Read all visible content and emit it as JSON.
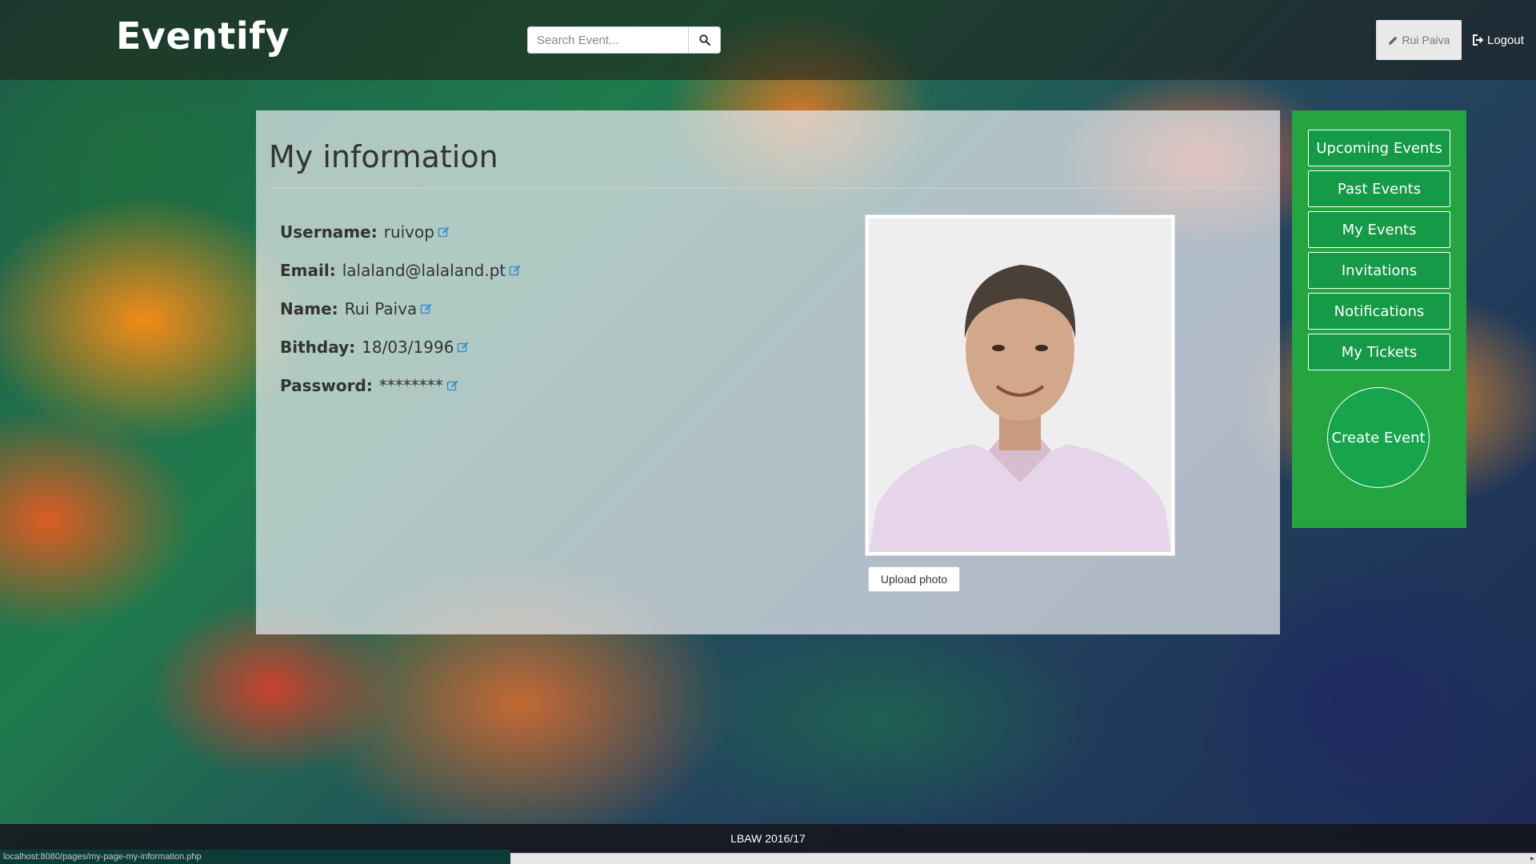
{
  "app": {
    "brand": "Eventify"
  },
  "search": {
    "placeholder": "Search Event..."
  },
  "user_menu": {
    "name": "Rui Paiva",
    "logout_label": "Logout"
  },
  "profile": {
    "title": "My information",
    "fields": [
      {
        "label": "Username:",
        "value": "ruivop"
      },
      {
        "label": "Email:",
        "value": "lalaland@lalaland.pt"
      },
      {
        "label": "Name:",
        "value": "Rui Paiva"
      },
      {
        "label": "Bithday:",
        "value": "18/03/1996"
      },
      {
        "label": "Password:",
        "value": "********"
      }
    ],
    "upload_label": "Upload photo"
  },
  "sidebar": {
    "items": [
      {
        "label": "Upcoming Events"
      },
      {
        "label": "Past Events"
      },
      {
        "label": "My Events"
      },
      {
        "label": "Invitations"
      },
      {
        "label": "Notifications"
      },
      {
        "label": "My Tickets"
      }
    ],
    "create_label": "Create Event"
  },
  "footer": {
    "text": "LBAW 2016/17"
  },
  "status_bar": {
    "url": "localhost:8080/pages/my-page-my-information.php"
  },
  "colors": {
    "sidebar_bg": "#24a53f",
    "sidebar_button": "#159a47",
    "panel_bg": "rgba(232,234,240,0.72)",
    "edit_icon": "#3a8fd0"
  },
  "icons": {
    "search": "magnifier-icon",
    "user": "pencil-icon",
    "logout": "logout-icon",
    "edit": "edit-icon"
  }
}
